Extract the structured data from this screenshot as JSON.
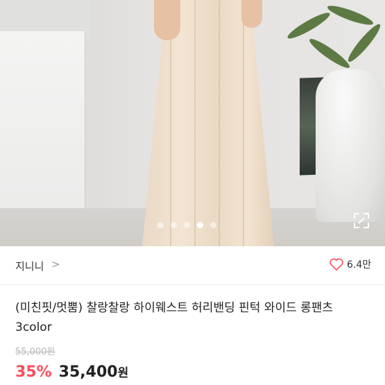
{
  "product_image": {
    "alt": "wide pleated long pants",
    "pagination": {
      "total": 5,
      "active_index": 3
    },
    "expand_icon": "expand-icon"
  },
  "seller": {
    "name": "지니니",
    "chevron": ">"
  },
  "likes": {
    "icon": "heart-icon",
    "count": "6.4만",
    "color": "#ff4d5a"
  },
  "product": {
    "title": "(미친핏/멋뿜) 찰랑찰랑 하이웨스트 허리밴딩 핀턱 와이드 롱팬츠 3color"
  },
  "pricing": {
    "original_price": "55,000원",
    "discount": "35%",
    "sale_price": "35,400",
    "currency": "원",
    "discount_color": "#ff4d5a"
  }
}
